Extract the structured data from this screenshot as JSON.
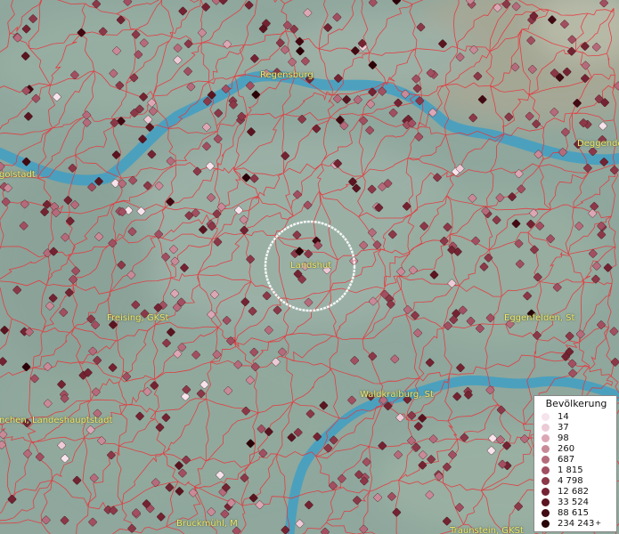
{
  "map": {
    "colors": {
      "terrain": "#8fa79d",
      "river": "#3f9fc4",
      "borders": "#e8343a",
      "marker": "#7a3038",
      "label": "#f1ea6a",
      "focus_ring": "#ffffff"
    },
    "places": [
      {
        "id": "regensburg",
        "label": "Regensburg"
      },
      {
        "id": "deggendorf",
        "label": "Deggendo"
      },
      {
        "id": "ingolstadt",
        "label": "golstadt"
      },
      {
        "id": "landshut",
        "label": "Landshut"
      },
      {
        "id": "freising",
        "label": "Freising, GKSt"
      },
      {
        "id": "eggenfelden",
        "label": "Eggenfelden, St"
      },
      {
        "id": "waldkraiburg",
        "label": "Waldkraiburg, St"
      },
      {
        "id": "muenchen",
        "label": "nchen, Landeshauptstadt"
      },
      {
        "id": "bruckmuehl",
        "label": "Bruckmühl, M"
      },
      {
        "id": "traunstein",
        "label": "Traunstein, GKSt"
      }
    ]
  },
  "legend": {
    "title": "Bevölkerung",
    "plus_sign": "+",
    "items": [
      {
        "label": "14",
        "color": "#f6e3ec"
      },
      {
        "label": "37",
        "color": "#eccbd6"
      },
      {
        "label": "98",
        "color": "#dca7b5"
      },
      {
        "label": "260",
        "color": "#c98a98"
      },
      {
        "label": "687",
        "color": "#b56b7b"
      },
      {
        "label": "1 815",
        "color": "#a14f61"
      },
      {
        "label": "4 798",
        "color": "#8b3848"
      },
      {
        "label": "12 682",
        "color": "#732332"
      },
      {
        "label": "33 524",
        "color": "#5a1520"
      },
      {
        "label": "88 615",
        "color": "#420a12"
      },
      {
        "label": "234 243",
        "color": "#2a0308"
      }
    ]
  }
}
